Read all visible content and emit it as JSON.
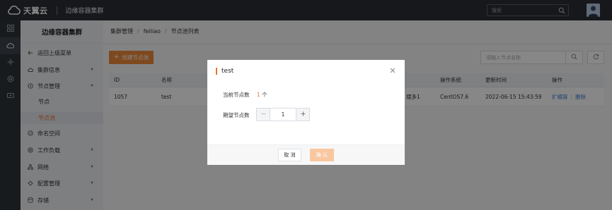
{
  "header": {
    "logo_text": "天翼云",
    "product_title": "边缘容器集群",
    "search_placeholder": "搜索"
  },
  "sidebar": {
    "title": "边缘容器集群",
    "items": [
      {
        "label": "返回上级菜单",
        "icon": "back-arrow-icon"
      },
      {
        "label": "集群信息",
        "icon": "cloud-icon",
        "has_arrow": true
      },
      {
        "label": "节点管理",
        "icon": "node-icon",
        "expanded": true
      },
      {
        "label": "节点",
        "sub": true
      },
      {
        "label": "节点池",
        "sub": true,
        "selected": true
      },
      {
        "label": "命名空间",
        "icon": "namespace-icon"
      },
      {
        "label": "工作负载",
        "icon": "workload-icon",
        "has_arrow": true
      },
      {
        "label": "网络",
        "icon": "network-icon",
        "has_arrow": true
      },
      {
        "label": "配置管理",
        "icon": "config-icon",
        "has_arrow": true
      },
      {
        "label": "存储",
        "icon": "storage-icon",
        "has_arrow": true
      }
    ]
  },
  "breadcrumb": [
    "集群管理",
    "feiliao",
    "节点池列表"
  ],
  "toolbar": {
    "create_label": "创建节点池",
    "search_placeholder": "请输入节点名称"
  },
  "table": {
    "columns": [
      "ID",
      "名称",
      "操作系统",
      "更新时间",
      "操作"
    ],
    "rows": [
      {
        "id": "1057",
        "name": "test",
        "partial": "摆多1",
        "os": "CentOS7.6",
        "updated": "2022-06-15 15:43:59",
        "actions": [
          "扩缩容",
          "删除"
        ]
      }
    ]
  },
  "modal": {
    "title": "test",
    "current_label": "当前节点数",
    "current_value": "1",
    "current_unit": "个",
    "desired_label": "期望节点数",
    "desired_value": "1",
    "cancel_label": "取 消",
    "confirm_label": "确 认"
  },
  "colors": {
    "accent": "#e8732e",
    "topbar": "#2b2f36",
    "link": "#3a7bd5"
  }
}
